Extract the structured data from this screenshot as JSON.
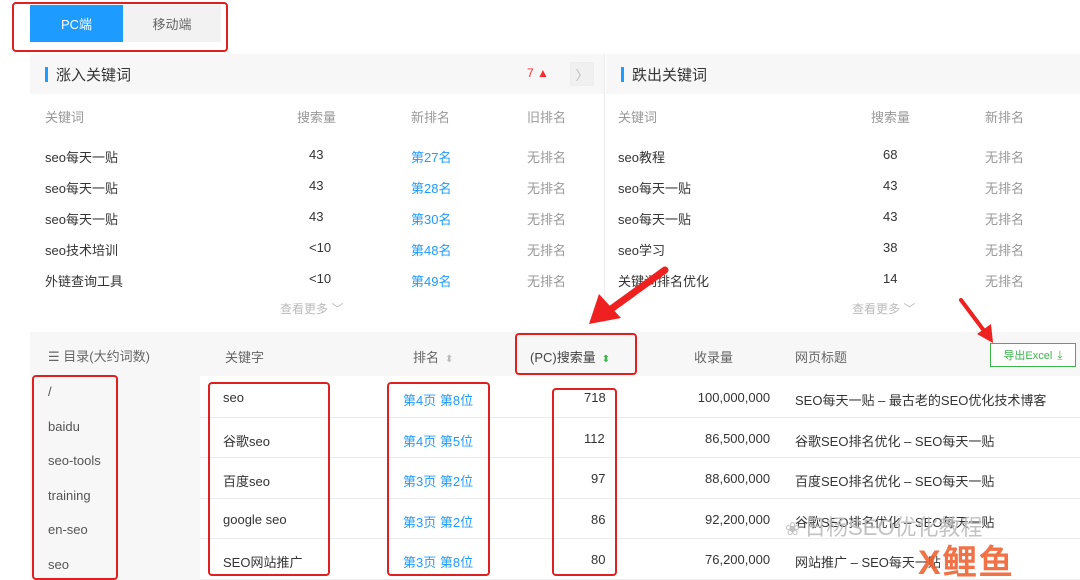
{
  "tabs": [
    {
      "label": "PC端",
      "active": true
    },
    {
      "label": "移动端",
      "active": false
    }
  ],
  "rising": {
    "title": "涨入关键词",
    "counter": "7 ▲",
    "next_icon": "chevron-right-icon",
    "headers": [
      "关键词",
      "搜索量",
      "新排名",
      "旧排名"
    ],
    "rows": [
      [
        "seo每天一贴",
        "43",
        "第27名",
        "无排名"
      ],
      [
        "seo每天一贴",
        "43",
        "第28名",
        "无排名"
      ],
      [
        "seo每天一贴",
        "43",
        "第30名",
        "无排名"
      ],
      [
        "seo技术培训",
        "<10",
        "第48名",
        "无排名"
      ],
      [
        "外链查询工具",
        "<10",
        "第49名",
        "无排名"
      ]
    ],
    "more": "查看更多 ﹀"
  },
  "falling": {
    "title": "跌出关键词",
    "headers": [
      "关键词",
      "搜索量",
      "新排名"
    ],
    "rows": [
      [
        "seo教程",
        "68",
        "无排名"
      ],
      [
        "seo每天一贴",
        "43",
        "无排名"
      ],
      [
        "seo每天一贴",
        "43",
        "无排名"
      ],
      [
        "seo学习",
        "38",
        "无排名"
      ],
      [
        "关键词排名优化",
        "14",
        "无排名"
      ]
    ],
    "more": "查看更多 ﹀"
  },
  "directory": {
    "header": "☰ 目录(大约词数)",
    "items": [
      "/",
      "baidu",
      "seo-tools",
      "training",
      "en-seo",
      "seo"
    ]
  },
  "table": {
    "headers": {
      "keyword": "关键字",
      "rank": "排名",
      "search": "(PC)搜索量",
      "indexed": "收录量",
      "title": "网页标题"
    },
    "export_label": "导出Excel",
    "rows": [
      {
        "keyword": "seo",
        "rank": "第4页 第8位",
        "search": "718",
        "indexed": "100,000,000",
        "title": "SEO每天一贴 – 最古老的SEO优化技术博客"
      },
      {
        "keyword": "谷歌seo",
        "rank": "第4页 第5位",
        "search": "112",
        "indexed": "86,500,000",
        "title": "谷歌SEO排名优化 – SEO每天一贴"
      },
      {
        "keyword": "百度seo",
        "rank": "第3页 第2位",
        "search": "97",
        "indexed": "88,600,000",
        "title": "百度SEO排名优化 – SEO每天一贴"
      },
      {
        "keyword": "google seo",
        "rank": "第3页 第2位",
        "search": "86",
        "indexed": "92,200,000",
        "title": "谷歌SEO排名优化 – SEO每天一贴"
      },
      {
        "keyword": "SEO网站推广",
        "rank": "第3页 第8位",
        "search": "80",
        "indexed": "76,200,000",
        "title": "网站推广 – SEO每天一贴"
      }
    ]
  },
  "watermark": {
    "text": "日杨SEO优化教程",
    "logo": "X鲤鱼"
  },
  "colors": {
    "accent": "#1e9bff",
    "annotation": "#e02020",
    "excel": "#3cb44b"
  }
}
